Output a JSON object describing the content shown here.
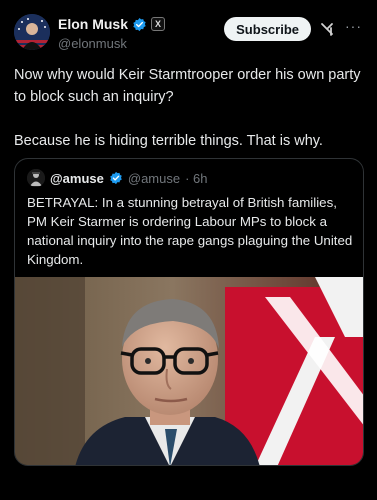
{
  "author": {
    "name": "Elon Musk",
    "handle": "@elonmusk",
    "x_badge": "X"
  },
  "actions": {
    "subscribe_label": "Subscribe",
    "more_label": "···"
  },
  "tweet": {
    "paragraphs": [
      "Now why would Keir Starmtrooper order his own party to block such an inquiry?",
      "Because he is hiding terrible things. That is why."
    ]
  },
  "quoted": {
    "name": "@amuse",
    "handle": "@amuse",
    "time": "· 6h",
    "text": "BETRAYAL: In a stunning betrayal of British families, PM Keir Starmer is ordering Labour MPs to block a national inquiry into the rape gangs plaguing the United Kingdom."
  },
  "colors": {
    "verified": "#1d9bf0",
    "background": "#000000",
    "flag_red": "#c8102e"
  }
}
